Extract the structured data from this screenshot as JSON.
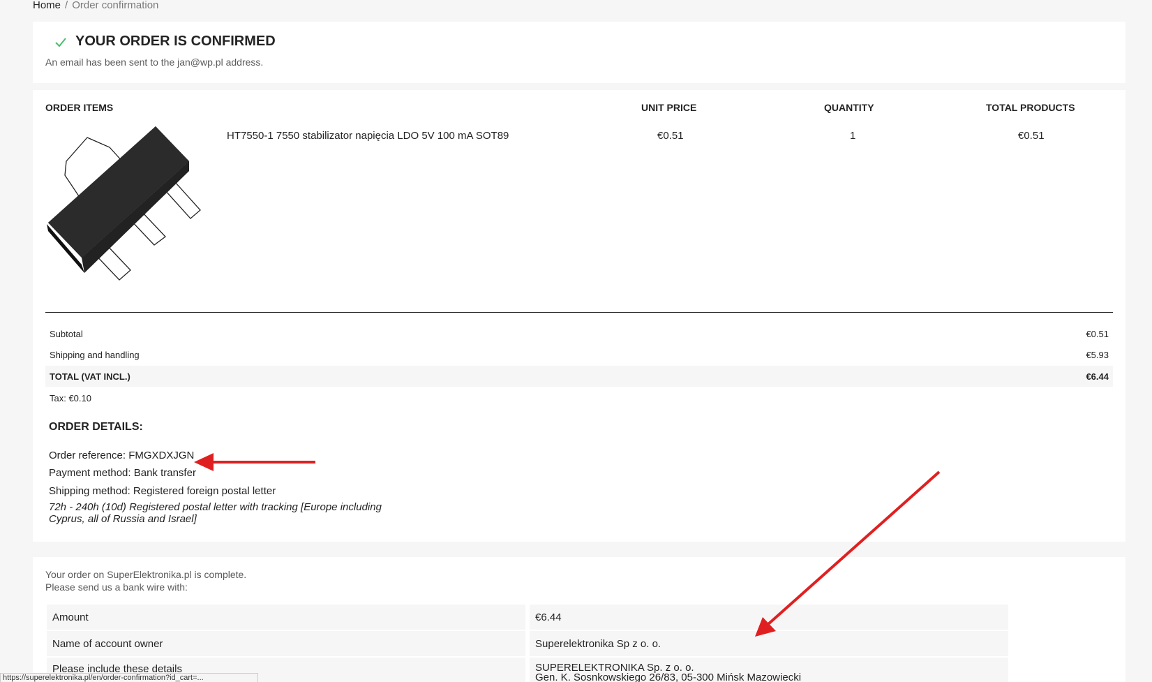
{
  "breadcrumb": {
    "home": "Home",
    "separator": "/",
    "current": "Order confirmation"
  },
  "confirmation": {
    "title": "YOUR ORDER IS CONFIRMED",
    "subtitle": "An email has been sent to the jan@wp.pl address.",
    "check_color": "#4cbb6c"
  },
  "order_items": {
    "headers": {
      "items": "ORDER ITEMS",
      "unit_price": "UNIT PRICE",
      "quantity": "QUANTITY",
      "total": "TOTAL PRODUCTS"
    },
    "item": {
      "name": "HT7550-1 7550 stabilizator napięcia LDO 5V 100 mA SOT89",
      "unit_price": "€0.51",
      "quantity": "1",
      "total": "€0.51"
    }
  },
  "summary": {
    "subtotal_label": "Subtotal",
    "subtotal_value": "€0.51",
    "shipping_label": "Shipping and handling",
    "shipping_value": "€5.93",
    "total_label": "TOTAL (VAT INCL.)",
    "total_value": "€6.44",
    "tax": "Tax: €0.10"
  },
  "order_details": {
    "title": "ORDER DETAILS:",
    "reference": "Order reference: FMGXDXJGN",
    "payment_method": "Payment method: Bank transfer",
    "shipping_method": "Shipping method: Registered foreign postal letter",
    "shipping_desc": "72h - 240h (10d) Registered postal letter with tracking [Europe including Cyprus, all of Russia and Israel]"
  },
  "payment": {
    "note_line1": "Your order on SuperElektronika.pl is complete.",
    "note_line2": "Please send us a bank wire with:",
    "rows": [
      {
        "label": "Amount",
        "value": "€6.44"
      },
      {
        "label": "Name of account owner",
        "value": "Superelektronika Sp z o. o."
      },
      {
        "label": "Please include these details",
        "value": "SUPERELEKTRONIKA Sp. z o. o.",
        "value2": "Gen. K. Sosnkowskiego 26/83, 05-300 Mińsk Mazowiecki"
      }
    ]
  },
  "status_bar": {
    "url": "https://superelektronika.pl/en/order-confirmation?id_cart=..."
  },
  "annotation_color": "#e02020"
}
